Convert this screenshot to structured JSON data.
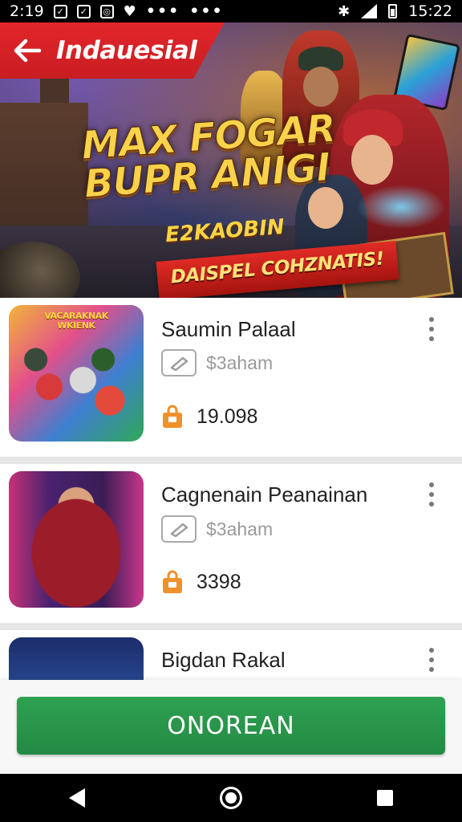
{
  "status_bar": {
    "time": "2:19",
    "notif_icons": [
      "check-box-icon",
      "check-box-icon",
      "android-box-icon",
      "heart-icon"
    ],
    "dots": "•••",
    "dots2": "•••",
    "right_time": "15:22",
    "icons": [
      "bluetooth-icon",
      "wifi-icon",
      "battery-icon"
    ]
  },
  "header": {
    "title": "Indauesial"
  },
  "hero": {
    "title": "MAX FOGAR\nBUPR ANIGI",
    "subtitle": "E2KAOBIN",
    "ribbon": "DAISPEL COHZNATIS!"
  },
  "items": [
    {
      "title": "Saumin Palaal",
      "price": "$3aham",
      "count": "19.098",
      "thumb_title": "VACARAKNAK\nWKIENK"
    },
    {
      "title": "Cagnenain Peanainan",
      "price": "$3aham",
      "count": "3398"
    },
    {
      "title": "Bigdan Rakal"
    }
  ],
  "cta": {
    "label": "ONOREAN"
  },
  "colors": {
    "header_red": "#e3262b",
    "cta_green": "#2fa152",
    "bag_orange": "#f0902a"
  }
}
